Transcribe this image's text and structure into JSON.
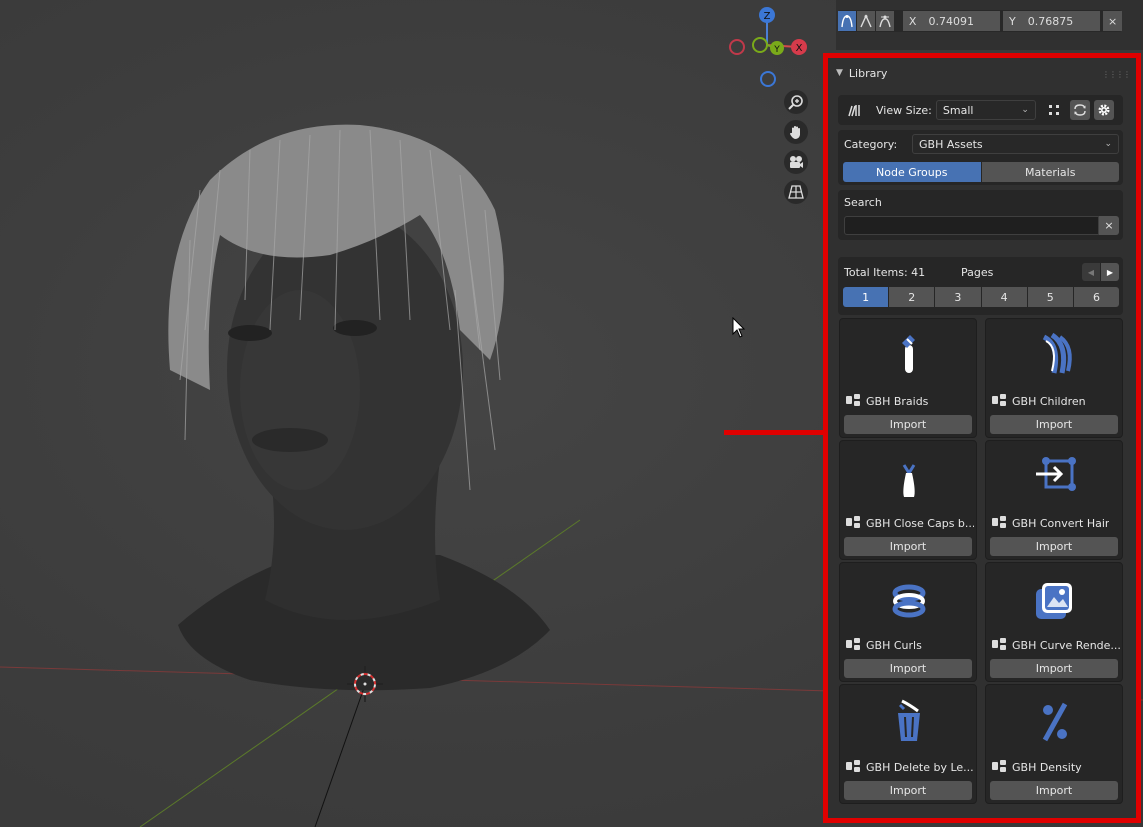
{
  "curve_editor": {
    "x_label": "X",
    "x_value": "0.74091",
    "y_label": "Y",
    "y_value": "0.76875",
    "close": "×"
  },
  "gizmo": {
    "z": "Z",
    "y": "Y",
    "x": "X"
  },
  "library": {
    "title": "Library",
    "view_size_label": "View Size:",
    "view_size_value": "Small",
    "category_label": "Category:",
    "category_value": "GBH Assets",
    "tabs": [
      "Node Groups",
      "Materials"
    ],
    "active_tab": "Node Groups",
    "search_label": "Search",
    "search_value": "",
    "search_clear": "×",
    "total_items": "Total Items: 41",
    "pages_label": "Pages",
    "pages": [
      "1",
      "2",
      "3",
      "4",
      "5",
      "6"
    ],
    "current_page": "1",
    "import_label": "Import",
    "assets": [
      {
        "name": "GBH Braids",
        "icon": "braids-icon"
      },
      {
        "name": "GBH Children",
        "icon": "children-icon"
      },
      {
        "name": "GBH Close Caps b...",
        "icon": "close-caps-icon"
      },
      {
        "name": "GBH Convert Hair",
        "icon": "convert-hair-icon"
      },
      {
        "name": "GBH Curls",
        "icon": "curls-icon"
      },
      {
        "name": "GBH Curve Rende...",
        "icon": "curve-render-icon"
      },
      {
        "name": "GBH Delete by Le...",
        "icon": "delete-icon"
      },
      {
        "name": "GBH Density",
        "icon": "density-icon"
      }
    ]
  },
  "colors": {
    "accent": "#4772b3",
    "highlight": "#e00000",
    "panel": "#303030",
    "icon_blue": "#4a73c4"
  }
}
